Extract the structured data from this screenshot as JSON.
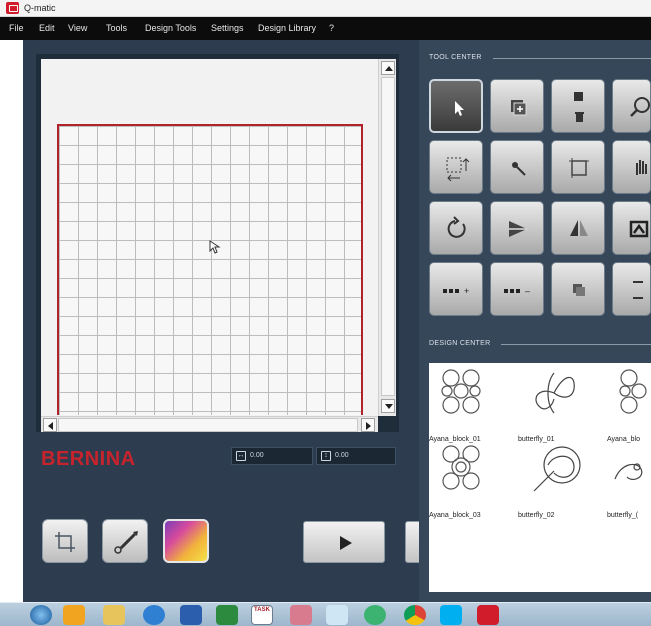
{
  "app": {
    "title": "Q-matic"
  },
  "menu": {
    "items": [
      "File",
      "Edit",
      "View",
      "Tools",
      "Design Tools",
      "Settings",
      "Design Library",
      "?"
    ]
  },
  "canvas": {
    "brand": "BERNINA",
    "readout_x": "0.00",
    "readout_y": "0.00"
  },
  "tool_center": {
    "title": "TOOL CENTER",
    "tools": [
      {
        "icon": "pointer-icon",
        "active": true
      },
      {
        "icon": "add-copy-icon"
      },
      {
        "icon": "delete-copy-icon"
      },
      {
        "icon": "zoom-in-icon"
      },
      {
        "icon": "resize-icon"
      },
      {
        "icon": "node-edit-icon"
      },
      {
        "icon": "crop-icon"
      },
      {
        "icon": "pan-hand-icon"
      },
      {
        "icon": "rotate-icon"
      },
      {
        "icon": "skew-icon"
      },
      {
        "icon": "mirror-icon"
      },
      {
        "icon": "shape-icon"
      },
      {
        "icon": "add-repeat-icon",
        "label": "+"
      },
      {
        "icon": "remove-repeat-icon",
        "label": "–"
      },
      {
        "icon": "layers-icon"
      },
      {
        "icon": "link-icon"
      }
    ]
  },
  "design_center": {
    "title": "DESIGN CENTER",
    "designs": [
      {
        "name": "Ayana_block_01"
      },
      {
        "name": "butterfly_01"
      },
      {
        "name": "Ayana_blo"
      },
      {
        "name": "Ayana_block_03"
      },
      {
        "name": "butterfly_02"
      },
      {
        "name": "butterfly_("
      }
    ]
  },
  "taskbar": {
    "icons": [
      "start-icon",
      "outlook-icon",
      "explorer-icon",
      "ie-icon",
      "word-icon",
      "excel-icon",
      "task-icon",
      "snipping-icon",
      "notepad-icon",
      "cloud-icon",
      "chrome-icon",
      "skype-icon",
      "qmatic-icon"
    ],
    "task_label": "TASK"
  },
  "colors": {
    "brand": "#c6232c",
    "panel": "#2d3d4f",
    "grid_border": "#b1222a"
  }
}
